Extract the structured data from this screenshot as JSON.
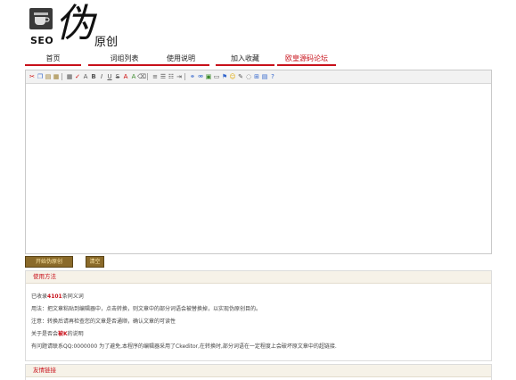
{
  "logo": {
    "seo_text": "SEO",
    "glyph": "伪",
    "sub": "原创"
  },
  "nav": [
    {
      "label": "首页",
      "highlight": false
    },
    {
      "label": "词组列表",
      "highlight": false
    },
    {
      "label": "使用说明",
      "highlight": false
    },
    {
      "label": "加入收藏",
      "highlight": false
    },
    {
      "label": "欧皇源码论坛",
      "highlight": true
    }
  ],
  "toolbar_icons": [
    "cut-icon",
    "copy-icon",
    "paste-icon",
    "paste-text-icon",
    "sep",
    "table-icon",
    "spellcheck-icon",
    "find-icon",
    "bold-icon",
    "italic-icon",
    "underline-icon",
    "strikethrough-icon",
    "font-color-icon",
    "highlight-icon",
    "eraser-icon",
    "sep",
    "align-icon",
    "ordered-list-icon",
    "unordered-list-icon",
    "indent-icon",
    "sep",
    "link-icon",
    "unlink-icon",
    "image-icon",
    "media-icon",
    "emoticon-icon",
    "smiley-icon",
    "insert-icon",
    "preview-icon",
    "fullscreen-icon",
    "code-icon",
    "help-icon"
  ],
  "buttons": {
    "start": "开始伪原创",
    "clear": "清空"
  },
  "usage": {
    "title": "使用方法",
    "line1_prefix": "已收录",
    "line1_count": "4101",
    "line1_suffix": "条同义词",
    "line2": "用法：把文章粘贴到编辑器中，点击转换，则文章中的部分词语会被替换掉，以实现伪原创目的。",
    "line3": "注意：转换后请再检查您的文章是否通顺，确认文章的可读性",
    "line4_prefix": "关于是否会",
    "line4_em": "被K",
    "line4_suffix": "的说明",
    "line5": "有问题请联系QQ:0000000 为了避免,本程序的编辑器采用了Ckeditor,在转换时,部分词语在一定程度上会破坏原文章中的超链接."
  },
  "links": {
    "title": "友情链接"
  }
}
